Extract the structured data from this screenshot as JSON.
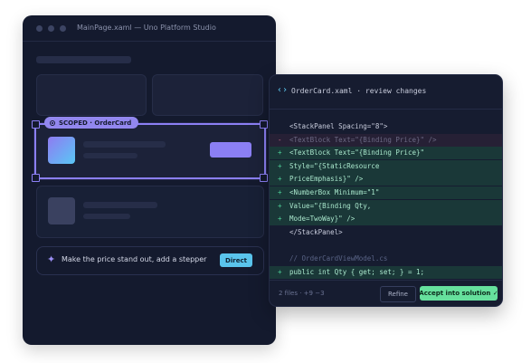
{
  "studio": {
    "title": "MainPage.xaml — Uno Platform Studio",
    "scoped_badge": "SCOPED · OrderCard",
    "prompt": {
      "text": "Make the price stand out, add a stepper",
      "direct_label": "Direct"
    }
  },
  "review": {
    "title": "OrderCard.xaml · review changes",
    "lines": [
      {
        "kind": "ctx",
        "sign": "",
        "text": "<StackPanel Spacing=\"8\">"
      },
      {
        "kind": "rem",
        "sign": "-",
        "text": "<TextBlock Text=\"{Binding Price}\" />"
      },
      {
        "kind": "add",
        "sign": "+",
        "text": "<TextBlock Text=\"{Binding Price}\""
      },
      {
        "kind": "add",
        "sign": "+",
        "text": "Style=\"{StaticResource"
      },
      {
        "kind": "add",
        "sign": "+",
        "text": "PriceEmphasis}\" />"
      },
      {
        "kind": "add",
        "sign": "+",
        "text": "<NumberBox Minimum=\"1\""
      },
      {
        "kind": "add",
        "sign": "+",
        "text": "Value=\"{Binding Qty,"
      },
      {
        "kind": "add",
        "sign": "+",
        "text": "Mode=TwoWay}\" />"
      },
      {
        "kind": "ctx",
        "sign": "",
        "text": "</StackPanel>"
      },
      {
        "kind": "blank",
        "sign": "",
        "text": ""
      },
      {
        "kind": "cmt",
        "sign": "",
        "text": "// OrderCardViewModel.cs"
      },
      {
        "kind": "add",
        "sign": "+",
        "text": "public int Qty { get; set; } = 1;"
      }
    ],
    "diffstat": "2 files · +9 −3",
    "refine_label": "Refine",
    "accept_label": "Accept into solution ✓"
  }
}
